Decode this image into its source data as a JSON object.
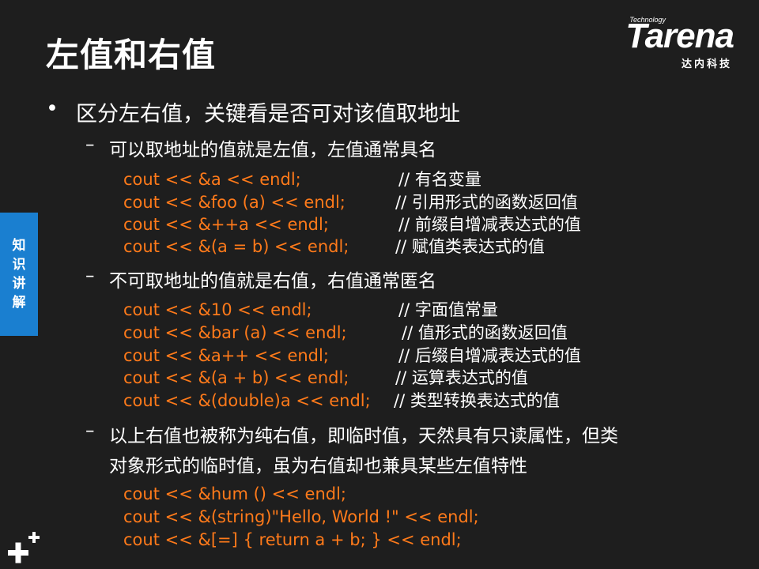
{
  "slide": {
    "title": "左值和右值",
    "side_tab": [
      "知",
      "识",
      "讲",
      "解"
    ]
  },
  "logo": {
    "small": "Technology",
    "brand": "Tarena",
    "cn": "达内科技"
  },
  "bullet": {
    "marker": "•",
    "text": "区分左右值，关键看是否可对该值取地址"
  },
  "sub1": {
    "dash": "–",
    "text": "可以取地址的值就是左值，左值通常具名",
    "lines": [
      {
        "code": "cout << &a << endl;",
        "comment": "// 有名变量"
      },
      {
        "code": "cout << &foo (a) << endl;",
        "comment": "// 引用形式的函数返回值"
      },
      {
        "code": "cout << &++a << endl;",
        "comment": "// 前缀自增减表达式的值"
      },
      {
        "code": "cout << &(a = b) << endl;",
        "comment": "// 赋值类表达式的值"
      }
    ]
  },
  "sub2": {
    "dash": "–",
    "text": "不可取地址的值就是右值，右值通常匿名",
    "lines": [
      {
        "code": "cout << &10 << endl;",
        "comment": "// 字面值常量"
      },
      {
        "code": "cout << &bar (a) << endl;",
        "comment": "// 值形式的函数返回值"
      },
      {
        "code": "cout << &a++ << endl;",
        "comment": "// 后缀自增减表达式的值"
      },
      {
        "code": "cout << &(a + b) << endl;",
        "comment": "// 运算表达式的值"
      },
      {
        "code": "cout << &(double)a << endl;",
        "comment": "// 类型转换表达式的值"
      }
    ]
  },
  "sub3": {
    "dash": "–",
    "text_line1": "以上右值也被称为纯右值，即临时值，天然具有只读属性，但类",
    "text_line2": "对象形式的临时值，虽为右值却也兼具某些左值特性",
    "lines": [
      {
        "code": "cout << &hum () << endl;"
      },
      {
        "code": "cout << &(string)\"Hello, World !\" << endl;"
      },
      {
        "code": "cout << &[=] { return a + b; } << endl;"
      }
    ]
  },
  "colors": {
    "background": "#1e1e1e",
    "code": "#ff7a1a",
    "accent": "#1a7fd0",
    "text": "#ffffff"
  },
  "icons": {
    "corner": "plus-plus-icon"
  }
}
